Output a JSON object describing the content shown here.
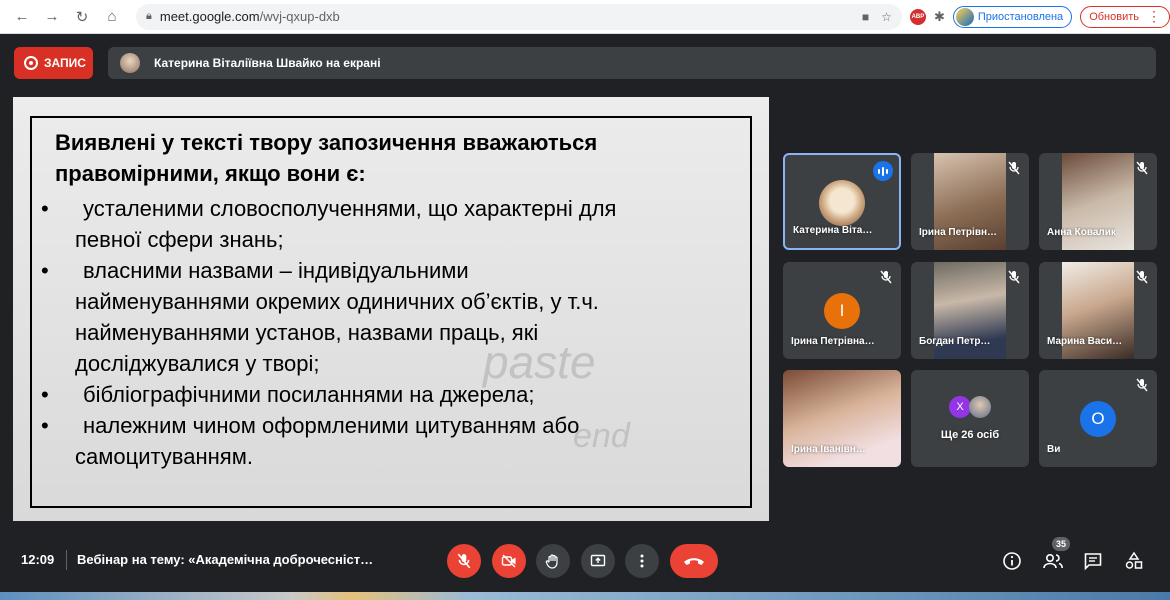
{
  "browser": {
    "url_host": "meet.google.com",
    "url_path": "/wvj-qxup-dxb",
    "abp_label": "ABP",
    "profile_label": "Приостановлена",
    "update_label": "Обновить"
  },
  "meet": {
    "record_label": "ЗАПИС",
    "presenting_text": "Катерина Віталіївна Швайко на екрані"
  },
  "slide": {
    "heading_line1": "Виявлені у тексті твору запозичення вважаються",
    "heading_line2": "правомірними, якщо вони є:",
    "bullet_char": "•",
    "items": [
      {
        "line1": "усталеними словосполученнями, що характерні для",
        "line2": "певної сфери знань;"
      },
      {
        "line1": "власними назвами – індивідуальними",
        "line2": "найменуваннями окремих одиничних об’єктів, у т.ч.",
        "line3": "найменуваннями установ, назвами праць, які",
        "line4": "досліджувалися у творі;"
      },
      {
        "line1": "бібліографічними посиланнями на джерела;"
      },
      {
        "line1": "належним чином оформленими цитуванням або",
        "line2": "самоцитуванням."
      }
    ]
  },
  "participants": [
    {
      "name": "Катерина Віта…"
    },
    {
      "name": "Ірина Петрівн…"
    },
    {
      "name": "Анна Ковалик"
    },
    {
      "name": "Ірина Петрівна…",
      "initial": "І"
    },
    {
      "name": "Богдан Петр…"
    },
    {
      "name": "Марина Васи…"
    },
    {
      "name": "Ірина Іванівн…"
    },
    {
      "name": "Ще 26 осіб",
      "initial": "Х"
    },
    {
      "name": "Ви",
      "initial": "О"
    }
  ],
  "bottom": {
    "time": "12:09",
    "meeting_title": "Вебінар на тему: «Академічна доброчесніст…",
    "people_count": "35"
  },
  "colors": {
    "meet_bg": "#202124",
    "tile_bg": "#3c4043",
    "accent_red": "#ea4335",
    "accent_blue": "#1a73e8",
    "active_border": "#8ab4f8"
  }
}
